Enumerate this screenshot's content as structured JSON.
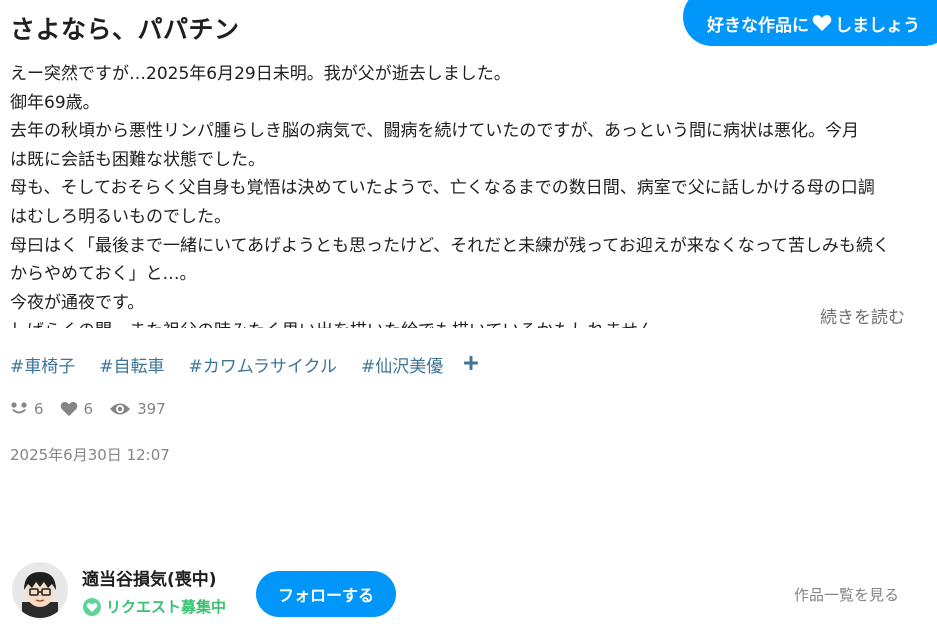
{
  "work": {
    "title": "さよなら、パパチン",
    "caption_lines": [
      "えー突然ですが…2025年6月29日未明。我が父が逝去しました。",
      "御年69歳。",
      "去年の秋頃から悪性リンパ腫らしき脳の病気で、闘病を続けていたのですが、あっという間に病状は悪化。今月",
      "は既に会話も困難な状態でした。",
      "母も、そしておそらく父自身も覚悟は決めていたようで、亡くなるまでの数日間、病室で父に話しかける母の口調",
      "はむしろ明るいものでした。",
      "母曰はく「最後まで一緒にいてあげようとも思ったけど、それだと未練が残ってお迎えが来なくなって苦しみも続く",
      "からやめておく」と…。",
      "今夜が通夜です。",
      "しばらくの間、また祖父の時みたく思い出を描いた絵でも描いているかもしれません。"
    ],
    "read_more": "続きを読む",
    "tags": [
      "#車椅子",
      "#自転車",
      "#カワムラサイクル",
      "#仙沢美優"
    ],
    "add_tag_icon": "plus-icon",
    "stats": {
      "reactions": "6",
      "likes": "6",
      "views": "397"
    },
    "date": "2025年6月30日 12:07"
  },
  "like_cta": {
    "before": "好きな作品に",
    "after": "しましょう",
    "icon": "heart-icon"
  },
  "author": {
    "name": "適当谷損気(喪中)",
    "request_label": "リクエスト募集中",
    "follow_label": "フォローする",
    "works_link": "作品一覧を見る"
  },
  "colors": {
    "accent": "#0096fa",
    "tag": "#3d7699",
    "muted": "#858585",
    "request": "#38c172"
  }
}
